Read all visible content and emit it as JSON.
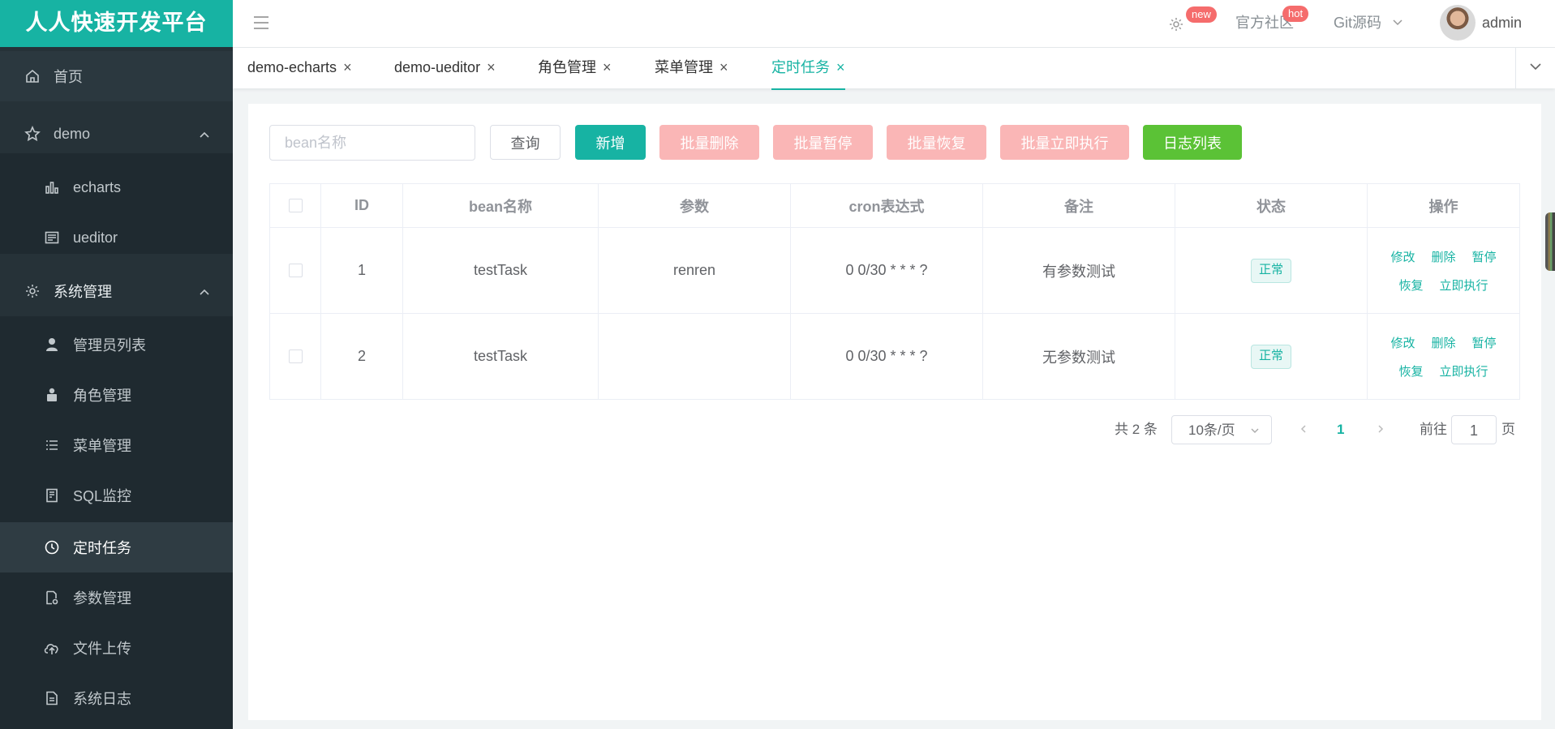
{
  "brand": "人人快速开发平台",
  "sidebar": {
    "items": [
      {
        "label": "首页",
        "icon": "home-icon"
      },
      {
        "label": "demo",
        "icon": "star-icon"
      },
      {
        "label": "echarts",
        "icon": "bar-chart-icon"
      },
      {
        "label": "ueditor",
        "icon": "editor-icon"
      },
      {
        "label": "系统管理",
        "icon": "gear-icon"
      },
      {
        "label": "管理员列表",
        "icon": "user-icon"
      },
      {
        "label": "角色管理",
        "icon": "role-icon"
      },
      {
        "label": "菜单管理",
        "icon": "list-icon"
      },
      {
        "label": "SQL监控",
        "icon": "sql-monitor-icon"
      },
      {
        "label": "定时任务",
        "icon": "clock-icon"
      },
      {
        "label": "参数管理",
        "icon": "param-doc-icon"
      },
      {
        "label": "文件上传",
        "icon": "cloud-upload-icon"
      },
      {
        "label": "系统日志",
        "icon": "doc-icon"
      }
    ],
    "active": "定时任务"
  },
  "header": {
    "new_badge": "new",
    "community": "官方社区",
    "hot_badge": "hot",
    "git": "Git源码",
    "user": "admin"
  },
  "tabs": [
    "demo-echarts",
    "demo-ueditor",
    "角色管理",
    "菜单管理",
    "定时任务"
  ],
  "active_tab": "定时任务",
  "toolbar": {
    "search_placeholder": "bean名称",
    "query": "查询",
    "add": "新增",
    "batch_delete": "批量删除",
    "batch_pause": "批量暂停",
    "batch_resume": "批量恢复",
    "batch_run": "批量立即执行",
    "log_list": "日志列表"
  },
  "table": {
    "headers": [
      "ID",
      "bean名称",
      "参数",
      "cron表达式",
      "备注",
      "状态",
      "操作"
    ],
    "rows": [
      {
        "id": "1",
        "bean": "testTask",
        "params": "renren",
        "cron": "0 0/30 * * * ?",
        "remark": "有参数测试",
        "status": "正常"
      },
      {
        "id": "2",
        "bean": "testTask",
        "params": "",
        "cron": "0 0/30 * * * ?",
        "remark": "无参数测试",
        "status": "正常"
      }
    ],
    "ops": {
      "edit": "修改",
      "delete": "删除",
      "pause": "暂停",
      "resume": "恢复",
      "run": "立即执行"
    }
  },
  "pagination": {
    "total": "共 2 条",
    "page_size": "10条/页",
    "current": "1",
    "goto_prefix": "前往",
    "goto_value": "1",
    "goto_suffix": "页"
  },
  "colors": {
    "brand": "#17b3a3",
    "sidebar_bg": "#263238",
    "danger_disabled": "#fab6b6",
    "success": "#5bc236",
    "badge": "#f56c6c"
  }
}
